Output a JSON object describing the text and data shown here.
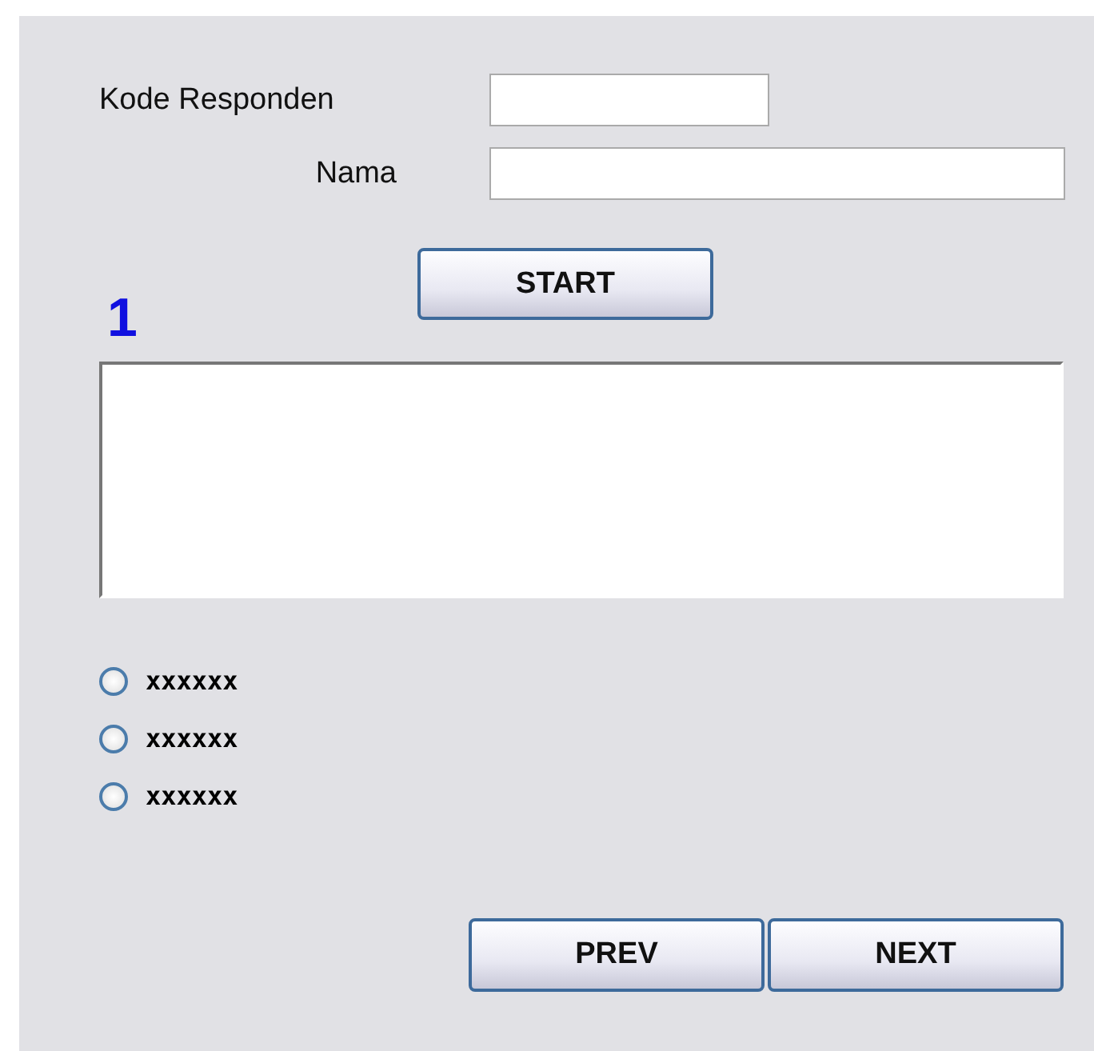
{
  "form": {
    "fields": [
      {
        "label": "Kode Responden"
      },
      {
        "label": "Nama"
      }
    ],
    "start_button": "START"
  },
  "question": {
    "number": "1"
  },
  "options": [
    {
      "label": "xxxxxx",
      "selected": false
    },
    {
      "label": "xxxxxx",
      "selected": false
    },
    {
      "label": "xxxxxx",
      "selected": false
    }
  ],
  "buttons": [
    "PREV",
    "NEXT"
  ]
}
